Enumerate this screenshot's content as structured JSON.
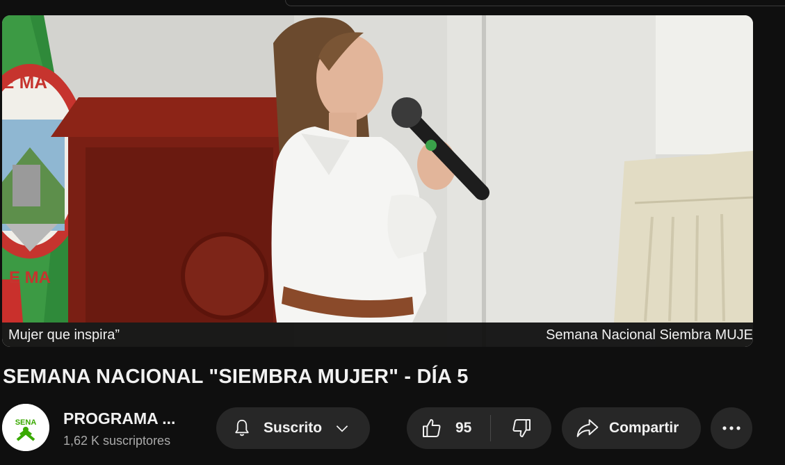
{
  "player": {
    "caption_left": "Mujer que inspira”",
    "caption_right": "Semana Nacional Siembra MUJE"
  },
  "video": {
    "title": "SEMANA NACIONAL \"SIEMBRA MUJER\" - DÍA 5"
  },
  "channel": {
    "name": "PROGRAMA ...",
    "subscribers": "1,62 K suscriptores",
    "avatar_text": "SENA",
    "avatar_color": "#39a900"
  },
  "actions": {
    "subscribe_label": "Suscrito",
    "like_count": "95",
    "share_label": "Compartir"
  },
  "icons": {
    "bell": "bell-icon",
    "chevron": "chevron-down-icon",
    "like": "thumbs-up-icon",
    "dislike": "thumbs-down-icon",
    "share": "share-arrow-icon",
    "more": "more-horizontal-icon"
  }
}
